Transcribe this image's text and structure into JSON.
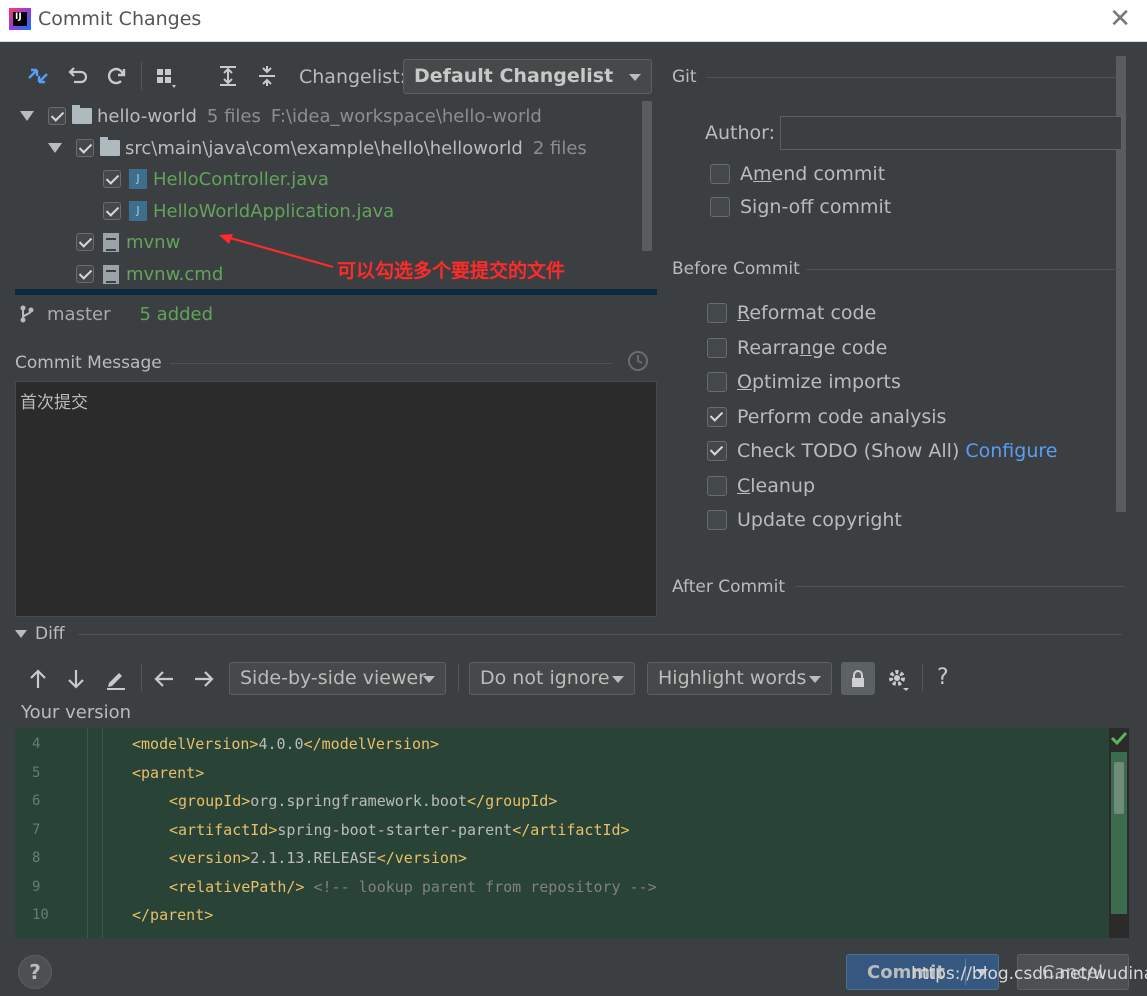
{
  "window": {
    "title": "Commit Changes",
    "close_glyph": "✕"
  },
  "changes": {
    "changelist_label": "Changelist:",
    "changelist_value": "Default Changelist",
    "tree": [
      {
        "name": "hello-world",
        "meta": "5 files",
        "path": "F:\\idea_workspace\\hello-world"
      },
      {
        "name": "src\\main\\java\\com\\example\\hello\\helloworld",
        "meta": "2 files"
      },
      {
        "name": "HelloController.java"
      },
      {
        "name": "HelloWorldApplication.java"
      },
      {
        "name": "mvnw"
      },
      {
        "name": "mvnw.cmd"
      }
    ],
    "annotation": "可以勾选多个要提交的文件",
    "branch": "master",
    "added": "5 added"
  },
  "commit_message": {
    "title": "Commit Message",
    "text": "首次提交"
  },
  "git": {
    "title": "Git",
    "author_label": "Author:",
    "author_value": "",
    "amend": {
      "prefix": "A",
      "mnemonic": "m",
      "rest": "end commit"
    },
    "signoff": {
      "prefix": "Si",
      "mnemonic": "g",
      "rest": "n-off commit"
    }
  },
  "before_commit": {
    "title": "Before Commit",
    "options": [
      {
        "prefix": "",
        "mnemonic": "R",
        "rest": "eformat code",
        "checked": false
      },
      {
        "prefix": "Rearra",
        "mnemonic": "n",
        "rest": "ge code",
        "checked": false
      },
      {
        "prefix": "",
        "mnemonic": "O",
        "rest": "ptimize imports",
        "checked": false
      },
      {
        "prefix": "Perform code analysis",
        "mnemonic": "",
        "rest": "",
        "checked": true
      },
      {
        "prefix": "Check TODO (Show All)",
        "mnemonic": "",
        "rest": "",
        "checked": true,
        "link": "Configure"
      },
      {
        "prefix": "",
        "mnemonic": "C",
        "rest": "leanup",
        "checked": false
      },
      {
        "prefix": "Update copyright",
        "mnemonic": "",
        "rest": "",
        "checked": false
      }
    ]
  },
  "after_commit": {
    "title": "After Commit"
  },
  "diff": {
    "title": "Diff",
    "viewer": "Side-by-side viewer",
    "ignore": "Do not ignore",
    "highlight": "Highlight words",
    "help": "?",
    "version_label": "Your version",
    "lines": [
      {
        "num": "4",
        "indent": 1,
        "open": "<modelVersion>",
        "value": "4.0.0",
        "close": "</modelVersion>"
      },
      {
        "num": "5",
        "indent": 1,
        "open": "<parent>",
        "value": "",
        "close": ""
      },
      {
        "num": "6",
        "indent": 2,
        "open": "<groupId>",
        "value": "org.springframework.boot",
        "close": "</groupId>"
      },
      {
        "num": "7",
        "indent": 2,
        "open": "<artifactId>",
        "value": "spring-boot-starter-parent",
        "close": "</artifactId>"
      },
      {
        "num": "8",
        "indent": 2,
        "open": "<version>",
        "value": "2.1.13.RELEASE",
        "close": "</version>"
      },
      {
        "num": "9",
        "indent": 2,
        "open": "<relativePath/>",
        "value": "",
        "close": "",
        "comment": "<!-- lookup parent from repository -->"
      },
      {
        "num": "10",
        "indent": 1,
        "open": "</parent>",
        "value": "",
        "close": ""
      }
    ]
  },
  "footer": {
    "help": "?",
    "commit": "Commit",
    "cancel": "Cancel",
    "watermark": "https://blog.csdn.net/wudinaniya"
  },
  "colors": {
    "added_file": "#62a35c",
    "link": "#589df6",
    "annotation": "#ff2a2a",
    "diff_bg": "#294436"
  }
}
